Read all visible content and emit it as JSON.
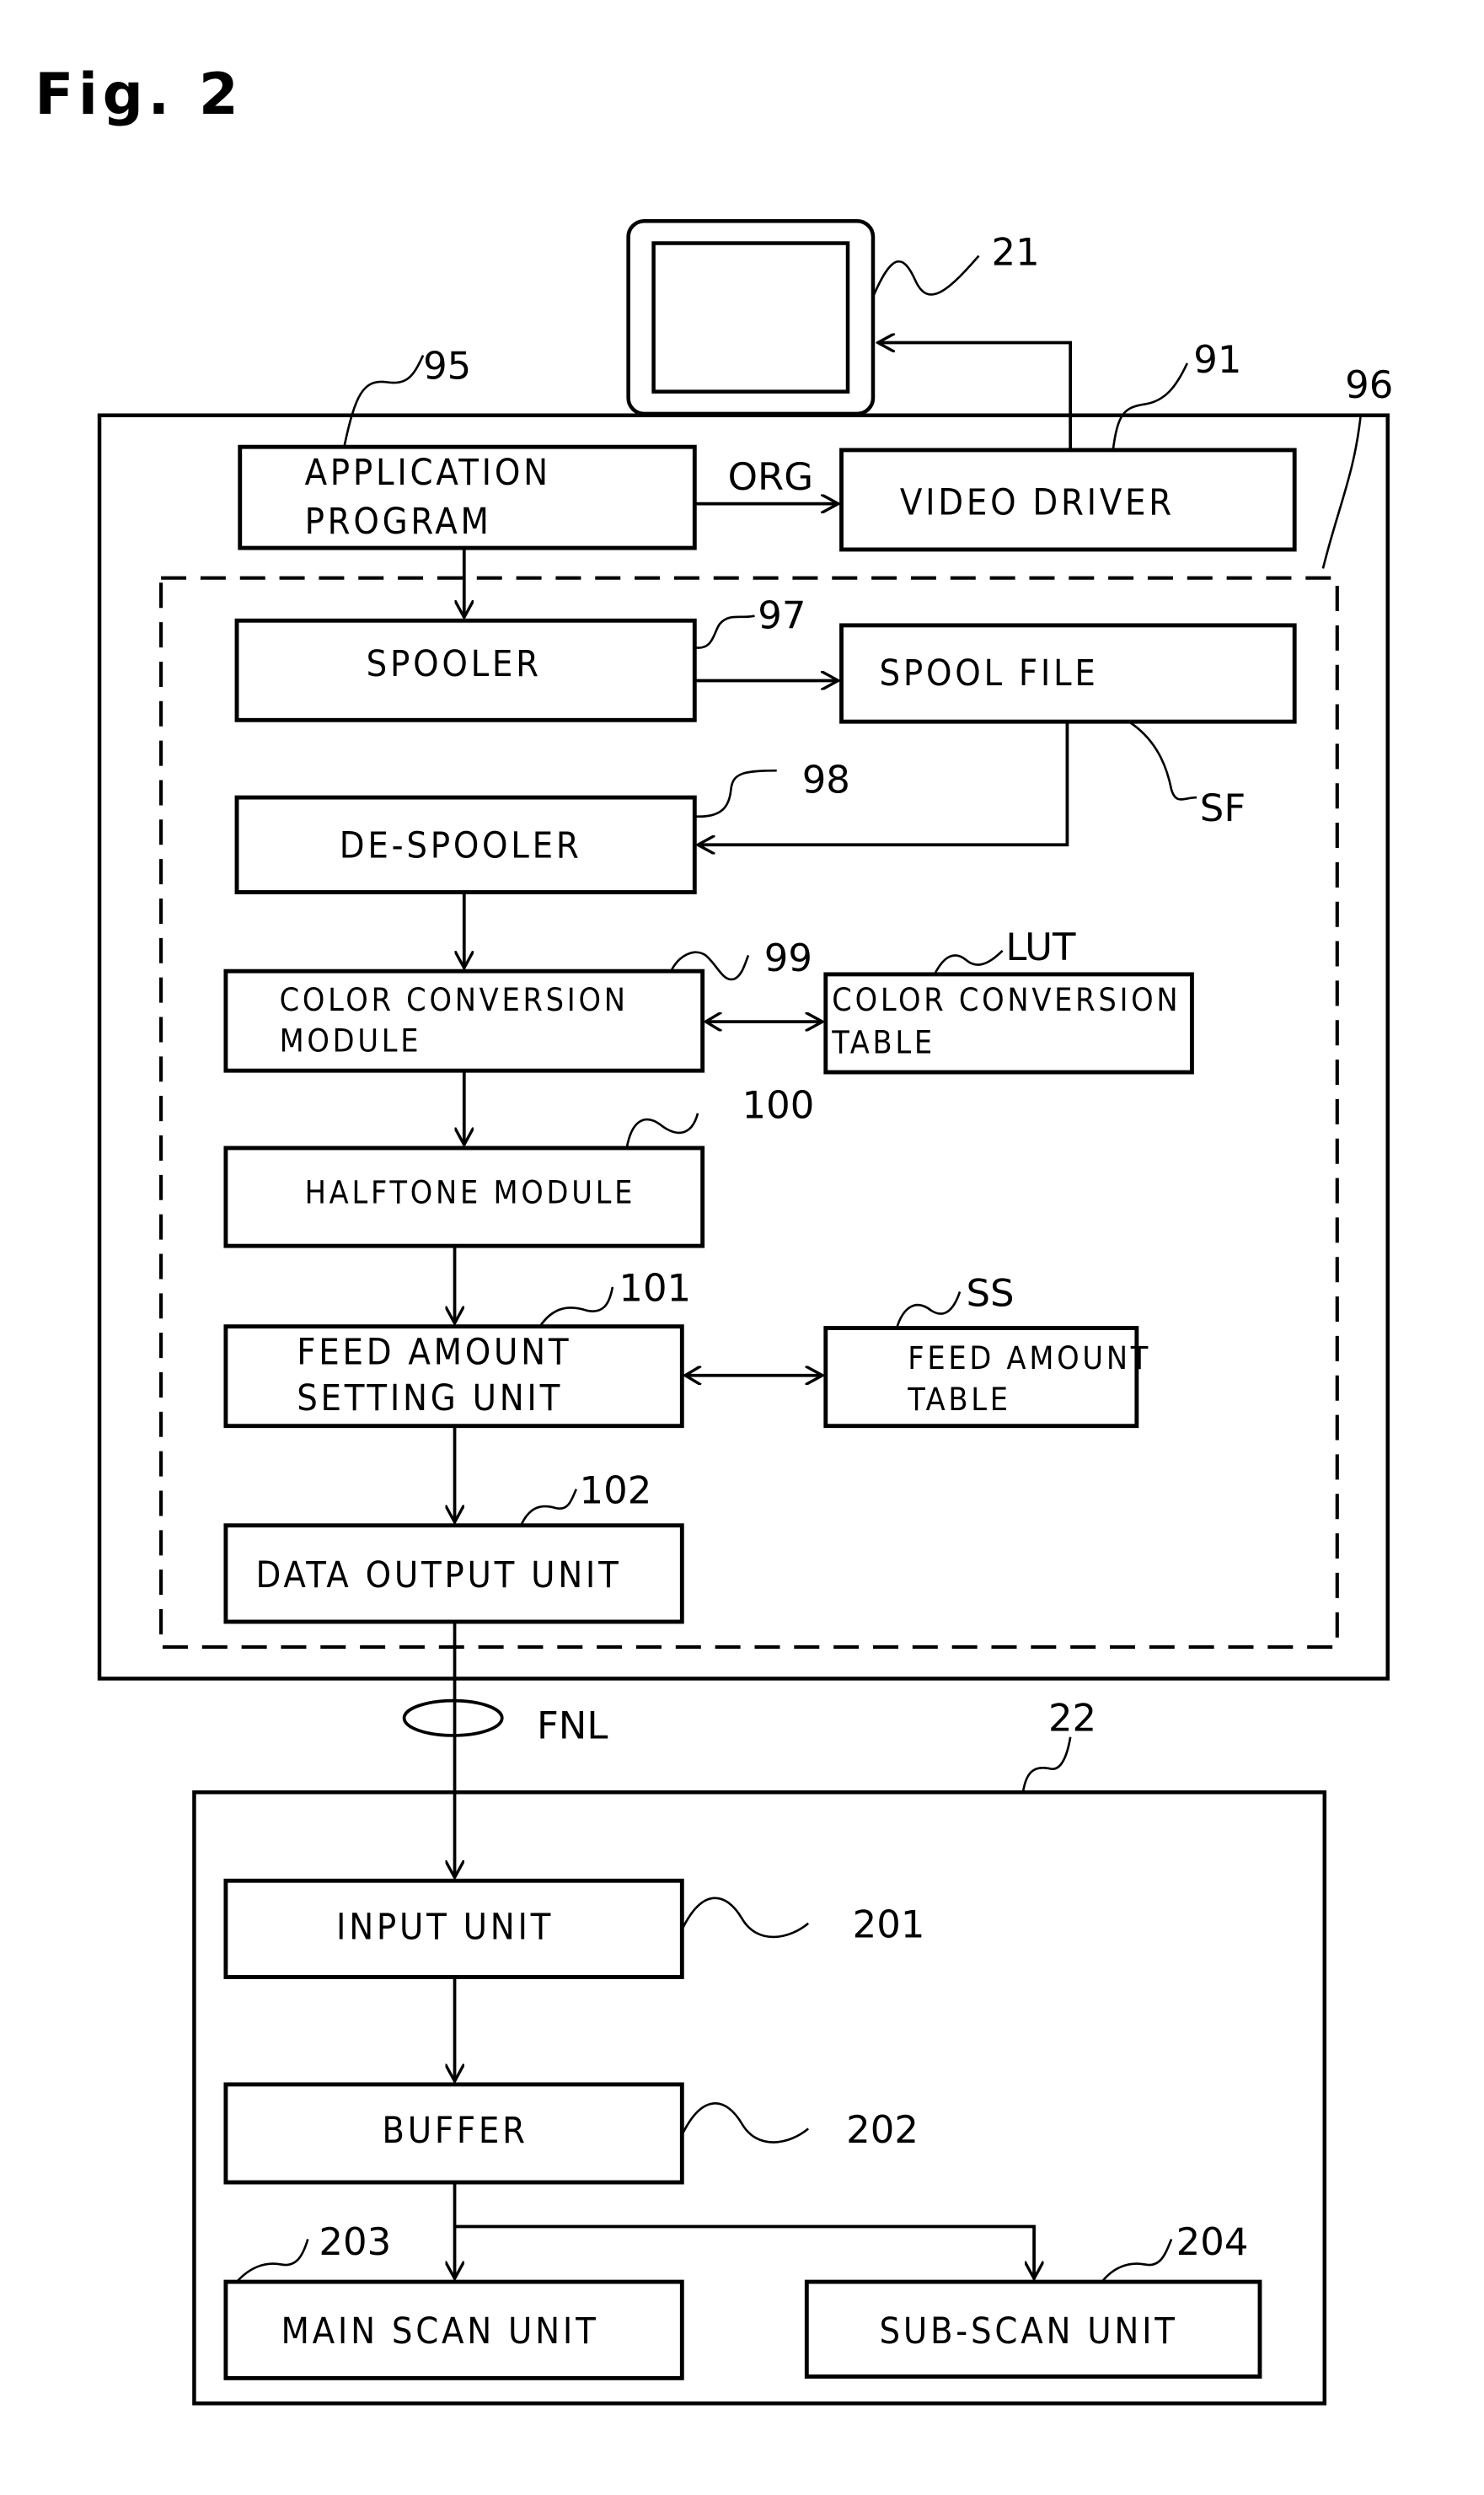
{
  "figure_title": "Fig. 2",
  "computer": {
    "ref": "96",
    "monitor_ref": "21",
    "application_program": {
      "line1": "APPLICATION",
      "line2": "PROGRAM",
      "ref": "95"
    },
    "video_driver": {
      "label": "VIDEO DRIVER",
      "ref": "91"
    },
    "org_label": "ORG",
    "printer_driver": {
      "spooler": {
        "label": "SPOOLER",
        "ref": "97"
      },
      "spool_file": {
        "label": "SPOOL FILE",
        "ref": "SF"
      },
      "de_spooler": {
        "label": "DE-SPOOLER",
        "ref": "98"
      },
      "color_conversion_module": {
        "line1": "COLOR CONVERSION",
        "line2": "MODULE",
        "ref": "99"
      },
      "color_conversion_table": {
        "line1": "COLOR CONVERSION",
        "line2": "TABLE",
        "ref": "LUT"
      },
      "halftone_module": {
        "label": "HALFTONE MODULE",
        "ref": "100"
      },
      "feed_amount_setting_unit": {
        "line1": "FEED AMOUNT",
        "line2": "SETTING UNIT",
        "ref": "101"
      },
      "feed_amount_table": {
        "line1": "FEED AMOUNT",
        "line2": "TABLE",
        "ref": "SS"
      },
      "data_output_unit": {
        "label": "DATA OUTPUT UNIT",
        "ref": "102"
      }
    }
  },
  "signal_label": "FNL",
  "printer": {
    "ref": "22",
    "input_unit": {
      "label": "INPUT UNIT",
      "ref": "201"
    },
    "buffer": {
      "label": "BUFFER",
      "ref": "202"
    },
    "main_scan_unit": {
      "label": "MAIN SCAN UNIT",
      "ref": "203"
    },
    "sub_scan_unit": {
      "label": "SUB-SCAN UNIT",
      "ref": "204"
    }
  }
}
